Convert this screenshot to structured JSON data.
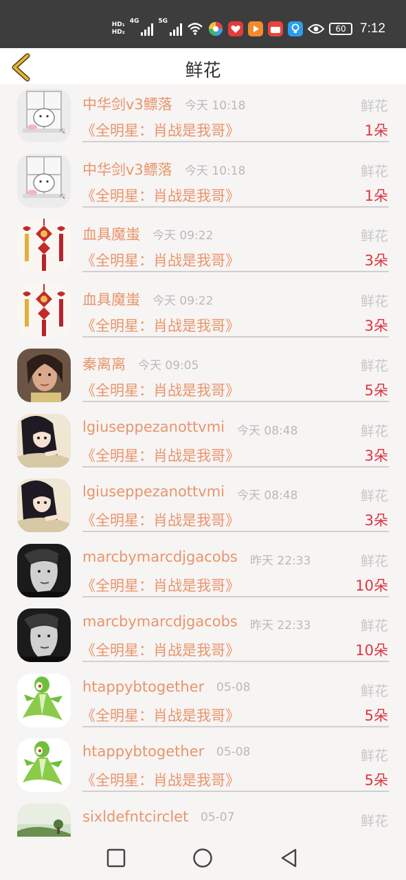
{
  "status_bar": {
    "hd1": "HD₁",
    "hd2": "HD₂",
    "net1": "4G",
    "net2": "5G",
    "battery": "60",
    "time": "7:12"
  },
  "header": {
    "title": "鲜花"
  },
  "records": [
    {
      "user": "中华剑v3鳔落",
      "time": "今天 10:18",
      "gift": "鲜花",
      "title": "《全明星：肖战是我哥》",
      "count": "1朵",
      "avatar": "window-cat"
    },
    {
      "user": "中华剑v3鳔落",
      "time": "今天 10:18",
      "gift": "鲜花",
      "title": "《全明星：肖战是我哥》",
      "count": "1朵",
      "avatar": "window-cat"
    },
    {
      "user": "血具魔蚩",
      "time": "今天 09:22",
      "gift": "鲜花",
      "title": "《全明星：肖战是我哥》",
      "count": "3朵",
      "avatar": "chinese-knot"
    },
    {
      "user": "血具魔蚩",
      "time": "今天 09:22",
      "gift": "鲜花",
      "title": "《全明星：肖战是我哥》",
      "count": "3朵",
      "avatar": "chinese-knot"
    },
    {
      "user": "秦离离",
      "time": "今天 09:05",
      "gift": "鲜花",
      "title": "《全明星：肖战是我哥》",
      "count": "5朵",
      "avatar": "portrait-woman"
    },
    {
      "user": "lgiuseppezanottvmi",
      "time": "今天 08:48",
      "gift": "鲜花",
      "title": "《全明星：肖战是我哥》",
      "count": "3朵",
      "avatar": "anime-girl"
    },
    {
      "user": "lgiuseppezanottvmi",
      "time": "今天 08:48",
      "gift": "鲜花",
      "title": "《全明星：肖战是我哥》",
      "count": "3朵",
      "avatar": "anime-girl"
    },
    {
      "user": "marcbymarcdjgacobs",
      "time": "昨天 22:33",
      "gift": "鲜花",
      "title": "《全明星：肖战是我哥》",
      "count": "10朵",
      "avatar": "bw-portrait"
    },
    {
      "user": "marcbymarcdjgacobs",
      "time": "昨天 22:33",
      "gift": "鲜花",
      "title": "《全明星：肖战是我哥》",
      "count": "10朵",
      "avatar": "bw-portrait"
    },
    {
      "user": "htappybtogether",
      "time": "05-08",
      "gift": "鲜花",
      "title": "《全明星：肖战是我哥》",
      "count": "5朵",
      "avatar": "green-creature"
    },
    {
      "user": "htappybtogether",
      "time": "05-08",
      "gift": "鲜花",
      "title": "《全明星：肖战是我哥》",
      "count": "5朵",
      "avatar": "green-creature"
    },
    {
      "user": "sixldefntcirclet",
      "time": "05-07",
      "gift": "鲜花",
      "title": "",
      "count": "",
      "avatar": "landscape"
    }
  ],
  "colors": {
    "accent": "#e8956a",
    "count": "#d9373f",
    "muted": "#b9b9b9",
    "back_icon": "#d9a83a"
  }
}
